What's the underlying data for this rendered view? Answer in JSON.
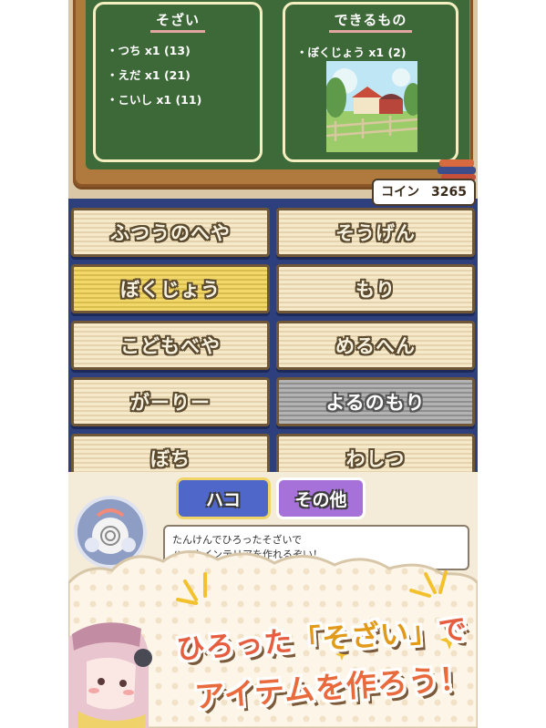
{
  "materials_panel": {
    "title": "そざい",
    "items": [
      "・つち x1 (13)",
      "・えだ x1 (21)",
      "・こいし x1 (11)"
    ]
  },
  "product_panel": {
    "title": "できるもの",
    "item": "・ぼくじょう x1 (2)"
  },
  "coin": {
    "label": "コイン",
    "value": "3265"
  },
  "rooms": [
    {
      "label": "ふつうのへや",
      "state": "normal"
    },
    {
      "label": "そうげん",
      "state": "normal"
    },
    {
      "label": "ぼくじょう",
      "state": "selected"
    },
    {
      "label": "もり",
      "state": "normal"
    },
    {
      "label": "こどもべや",
      "state": "normal"
    },
    {
      "label": "めるへん",
      "state": "normal"
    },
    {
      "label": "がーりー",
      "state": "normal"
    },
    {
      "label": "よるのもり",
      "state": "locked"
    },
    {
      "label": "ぼち",
      "state": "normal"
    },
    {
      "label": "わしつ",
      "state": "normal"
    }
  ],
  "tabs": {
    "box": "ハコ",
    "other": "その他"
  },
  "message": {
    "line1": "たんけんでひろったそざいで",
    "line2": "ハコやインテリアを作れるぞい！"
  },
  "promo": {
    "line1_pre": "ひろった",
    "line1_quote": "「そざい」",
    "line1_post": "で",
    "line2": "アイテムを作ろう！"
  },
  "colors": {
    "board_green": "#3e6a3a",
    "grid_bg": "#2e3f7d",
    "room_selected": "#f2d86a",
    "tab_box": "#4f67c9",
    "tab_other": "#a671d9",
    "promo_text": "#e65e40"
  }
}
